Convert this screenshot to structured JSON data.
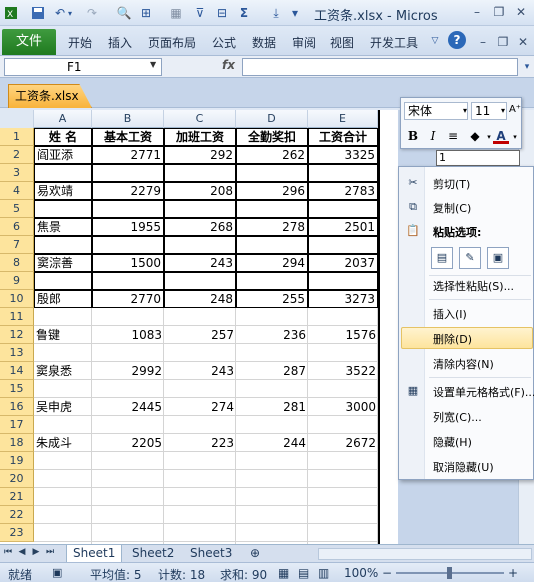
{
  "app": {
    "title": "工资条.xlsx - Micros",
    "controls": {
      "minimize": "–",
      "restore": "❐",
      "close": "✕"
    },
    "ribbon_extra": {
      "help": "?"
    }
  },
  "ribbon": {
    "file_tab": "文件",
    "tabs": [
      "开始",
      "插入",
      "页面布局",
      "公式",
      "数据",
      "审阅",
      "视图",
      "开发工具"
    ]
  },
  "formula_bar": {
    "name_box": "F1",
    "fx": "fx",
    "value": ""
  },
  "workbook": {
    "tab": "工资条.xlsx"
  },
  "columns": [
    "A",
    "B",
    "C",
    "D",
    "E"
  ],
  "rows": [
    "1",
    "2",
    "3",
    "4",
    "5",
    "6",
    "7",
    "8",
    "9",
    "10",
    "11",
    "12",
    "13",
    "14",
    "15",
    "16",
    "17",
    "18",
    "19",
    "20",
    "21",
    "22",
    "23"
  ],
  "table": {
    "header": [
      "姓 名",
      "基本工资",
      "加班工资",
      "全勤奖扣",
      "工资合计"
    ],
    "records": [
      {
        "row": 2,
        "name": "阎亚添",
        "b": "2771",
        "c": "292",
        "d": "262",
        "e": "3325"
      },
      {
        "row": 4,
        "name": "易欢靖",
        "b": "2279",
        "c": "208",
        "d": "296",
        "e": "2783"
      },
      {
        "row": 6,
        "name": "焦景",
        "b": "1955",
        "c": "268",
        "d": "278",
        "e": "2501"
      },
      {
        "row": 8,
        "name": "窦淙善",
        "b": "1500",
        "c": "243",
        "d": "294",
        "e": "2037"
      },
      {
        "row": 10,
        "name": "殷郎",
        "b": "2770",
        "c": "248",
        "d": "255",
        "e": "3273"
      },
      {
        "row": 12,
        "name": "鲁键",
        "b": "1083",
        "c": "257",
        "d": "236",
        "e": "1576"
      },
      {
        "row": 14,
        "name": "窦泉悉",
        "b": "2992",
        "c": "243",
        "d": "287",
        "e": "3522"
      },
      {
        "row": 16,
        "name": "吴申虎",
        "b": "2445",
        "c": "274",
        "d": "281",
        "e": "3000"
      },
      {
        "row": 18,
        "name": "朱成斗",
        "b": "2205",
        "c": "223",
        "d": "244",
        "e": "2672"
      }
    ]
  },
  "mini_toolbar": {
    "font": "宋体",
    "size": "11",
    "bold": "B",
    "italic": "I",
    "grow": "A⁺",
    "shrink": "A⁻",
    "font_color": "A",
    "partial_cell": "1"
  },
  "context_menu": {
    "cut": "剪切(T)",
    "copy": "复制(C)",
    "paste_options": "粘贴选项:",
    "paste_special": "选择性粘贴(S)...",
    "insert": "插入(I)",
    "delete": "删除(D)",
    "clear": "清除内容(N)",
    "format_cells": "设置单元格格式(F)...",
    "col_width": "列宽(C)...",
    "hide": "隐藏(H)",
    "unhide": "取消隐藏(U)"
  },
  "sheets": [
    "Sheet1",
    "Sheet2",
    "Sheet3"
  ],
  "status": {
    "mode": "就绪",
    "average": "平均值: 5",
    "count": "计数: 18",
    "sum": "求和: 90",
    "zoom": "100%",
    "zoom_out": "−",
    "zoom_in": "+"
  },
  "colors": {
    "accent": "#1f7a1f",
    "row_header_selected": "#fde49d",
    "menu_highlight": "#fde49d"
  }
}
